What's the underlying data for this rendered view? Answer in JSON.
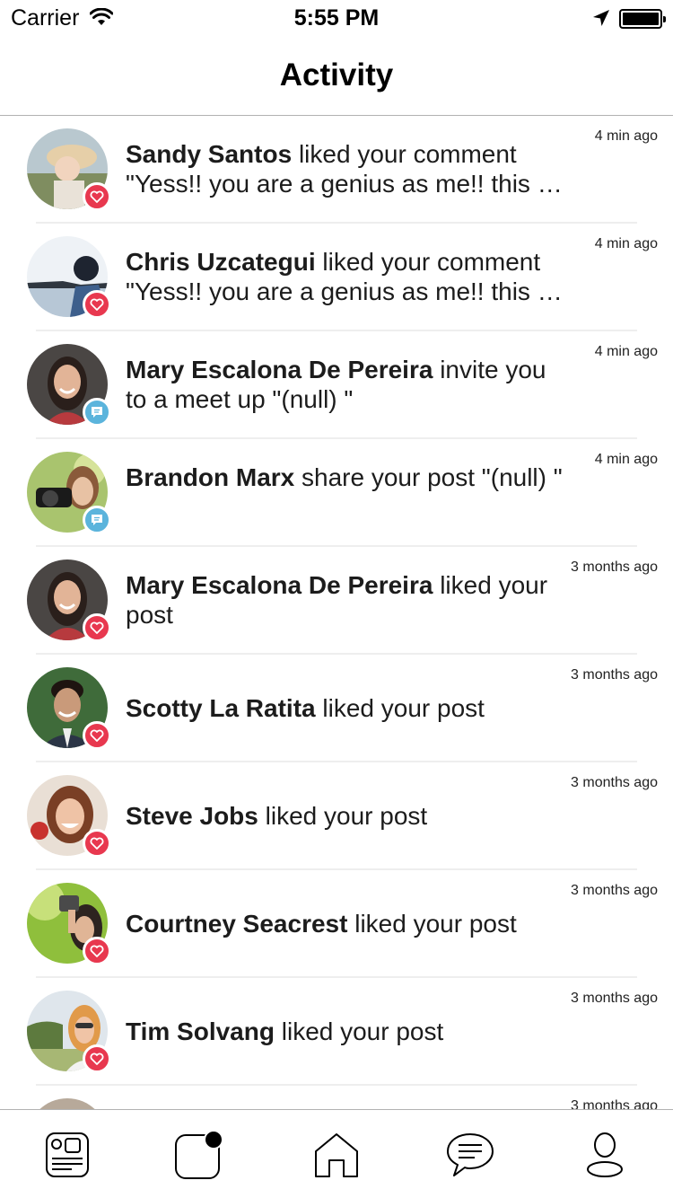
{
  "status_bar": {
    "carrier": "Carrier",
    "time": "5:55 PM"
  },
  "header": {
    "title": "Activity"
  },
  "colors": {
    "like_badge": "#e8384f",
    "comment_badge": "#5bb4dc"
  },
  "activities": [
    {
      "name": "Sandy Santos",
      "action": " liked your comment",
      "snippet": "\"Yess!! you are a genius as me!! this is the best comment ever\"",
      "time": "4 min ago",
      "badge": "heart-icon"
    },
    {
      "name": "Chris Uzcategui",
      "action": " liked your comment",
      "snippet": "\"Yess!! you are a genius as me!! this is the best comment ever\"",
      "time": "4 min ago",
      "badge": "heart-icon"
    },
    {
      "name": "Mary Escalona De Pereira",
      "action": " invite you to a meet up \"(null) \"",
      "snippet": "",
      "time": "4 min ago",
      "badge": "chat-icon"
    },
    {
      "name": "Brandon Marx",
      "action": "  share your post \"(null) \"",
      "snippet": "",
      "time": "4 min ago",
      "badge": "chat-icon"
    },
    {
      "name": "Mary Escalona De Pereira",
      "action": "  liked your post",
      "snippet": "",
      "time": "3 months ago",
      "badge": "heart-icon"
    },
    {
      "name": "Scotty La Ratita",
      "action": "  liked your post",
      "snippet": "",
      "time": "3 months ago",
      "badge": "heart-icon"
    },
    {
      "name": "Steve Jobs",
      "action": "  liked your post",
      "snippet": "",
      "time": "3 months ago",
      "badge": "heart-icon"
    },
    {
      "name": "Courtney Seacrest",
      "action": "  liked your post",
      "snippet": "",
      "time": "3 months ago",
      "badge": "heart-icon"
    },
    {
      "name": "Tim Solvang",
      "action": "  liked your post",
      "snippet": "",
      "time": "3 months ago",
      "badge": "heart-icon"
    },
    {
      "name": "",
      "action": "",
      "snippet": "",
      "time": "3 months ago",
      "badge": ""
    }
  ],
  "tab_bar": {
    "tabs": [
      {
        "icon": "news-feed-icon"
      },
      {
        "icon": "activity-icon"
      },
      {
        "icon": "home-icon"
      },
      {
        "icon": "messages-icon"
      },
      {
        "icon": "profile-icon"
      }
    ]
  }
}
